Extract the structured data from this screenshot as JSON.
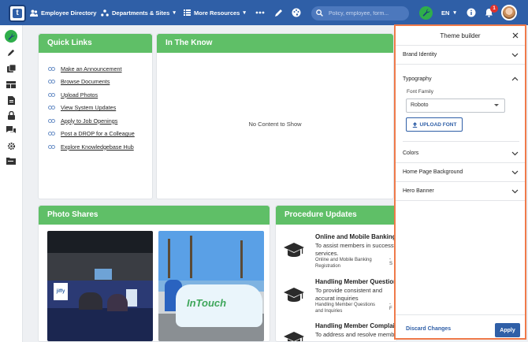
{
  "topbar": {
    "logo_letter": "t",
    "nav": [
      {
        "label": "Employee Directory"
      },
      {
        "label": "Departments & Sites"
      },
      {
        "label": "More Resources"
      }
    ],
    "search_placeholder": "Policy, employee, form...",
    "language": "EN",
    "notification_count": "1"
  },
  "quick_links": {
    "title": "Quick Links",
    "items": [
      "Make an Announcement",
      "Browse Documents",
      "Upload Photos",
      "View System Updates",
      "Apply to Job Openings",
      "Post a DROP for a Colleague",
      "Explore Knowledgebase Hub"
    ]
  },
  "in_the_know": {
    "title": "In The Know",
    "empty_text": "No Content to Show"
  },
  "photo_shares": {
    "title": "Photo Shares",
    "photo1_sign": "jiffy",
    "photo2_sign": "InTouch"
  },
  "procedure_updates": {
    "title": "Procedure Updates",
    "items": [
      {
        "title": "Online and Mobile Banking R",
        "desc": "To assist members in successful services.",
        "meta": "Online and Mobile Banking Registration",
        "dash": "- S"
      },
      {
        "title": "Handling Member Questions",
        "desc": "To provide consistent and accurat inquiries",
        "meta": "Handling Member Questions and Inquiries",
        "dash": "- F"
      },
      {
        "title": "Handling Member Complaints",
        "desc": "To address and resolve member",
        "meta": "",
        "dash": ""
      }
    ]
  },
  "theme_builder": {
    "title": "Theme builder",
    "sections": {
      "brand_identity": "Brand Identity",
      "typography": "Typography",
      "colors": "Colors",
      "home_background": "Home Page Background",
      "hero_banner": "Hero Banner"
    },
    "font_family_label": "Font Family",
    "font_family_value": "Roboto",
    "upload_font": "UPLOAD FONT",
    "discard": "Discard Changes",
    "apply": "Apply"
  },
  "colors": {
    "topbar": "#2f5fa7",
    "card_header": "#5fbf67",
    "accent_green": "#2fae4b",
    "panel_border": "#ef7a4a"
  }
}
